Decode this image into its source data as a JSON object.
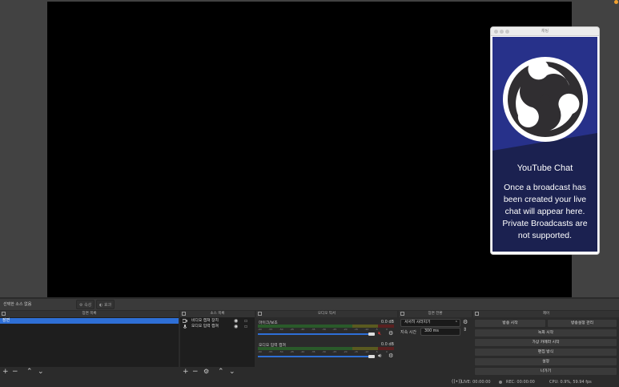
{
  "chat": {
    "window_title": "채팅",
    "heading": "YouTube Chat",
    "message": "Once a broadcast has been created your live chat will appear here. Private Broadcasts are not supported."
  },
  "context": {
    "label": "선택한 소스 없음",
    "properties": "속성",
    "filters": "효과"
  },
  "scenes": {
    "title": "장면 목록",
    "items": [
      "장면"
    ]
  },
  "sources": {
    "title": "소스 목록",
    "items": [
      {
        "name": "비디오 캡쳐 장치",
        "icon": "camera-icon"
      },
      {
        "name": "오디오 입력 캡쳐",
        "icon": "microphone-icon"
      }
    ]
  },
  "mixer": {
    "title": "오디오 믹서",
    "ticks": [
      "-60",
      "-55",
      "-50",
      "-45",
      "-40",
      "-35",
      "-30",
      "-25",
      "-20",
      "-15",
      "-10",
      "-5",
      "0"
    ],
    "channels": [
      {
        "name": "마이크/보조",
        "db": "0.0 dB",
        "muted": true
      },
      {
        "name": "오디오 입력 캡쳐",
        "db": "0.0 dB",
        "muted": false
      }
    ]
  },
  "transitions": {
    "title": "장면 전환",
    "selected": "서서히 사라지기",
    "duration_label": "지속 시간",
    "duration_value": "300 ms"
  },
  "controls": {
    "title": "제어",
    "start_streaming": "방송 시작",
    "manage_broadcast": "방송설정 관리",
    "start_recording": "녹화 시작",
    "start_virtual_camera": "가상 카메라 시작",
    "studio_mode": "편집 방식",
    "settings": "설정",
    "exit": "나가기"
  },
  "status": {
    "live": "LIVE: 00:00:00",
    "rec": "REC: 00:00:00",
    "cpu": "CPU: 0.9%, 59.94 fps"
  },
  "colors": {
    "accent": "#2e6fd6",
    "chat_bg": "#1a2152",
    "notification_dot": "#f0a030",
    "mute_red": "#d03030"
  }
}
